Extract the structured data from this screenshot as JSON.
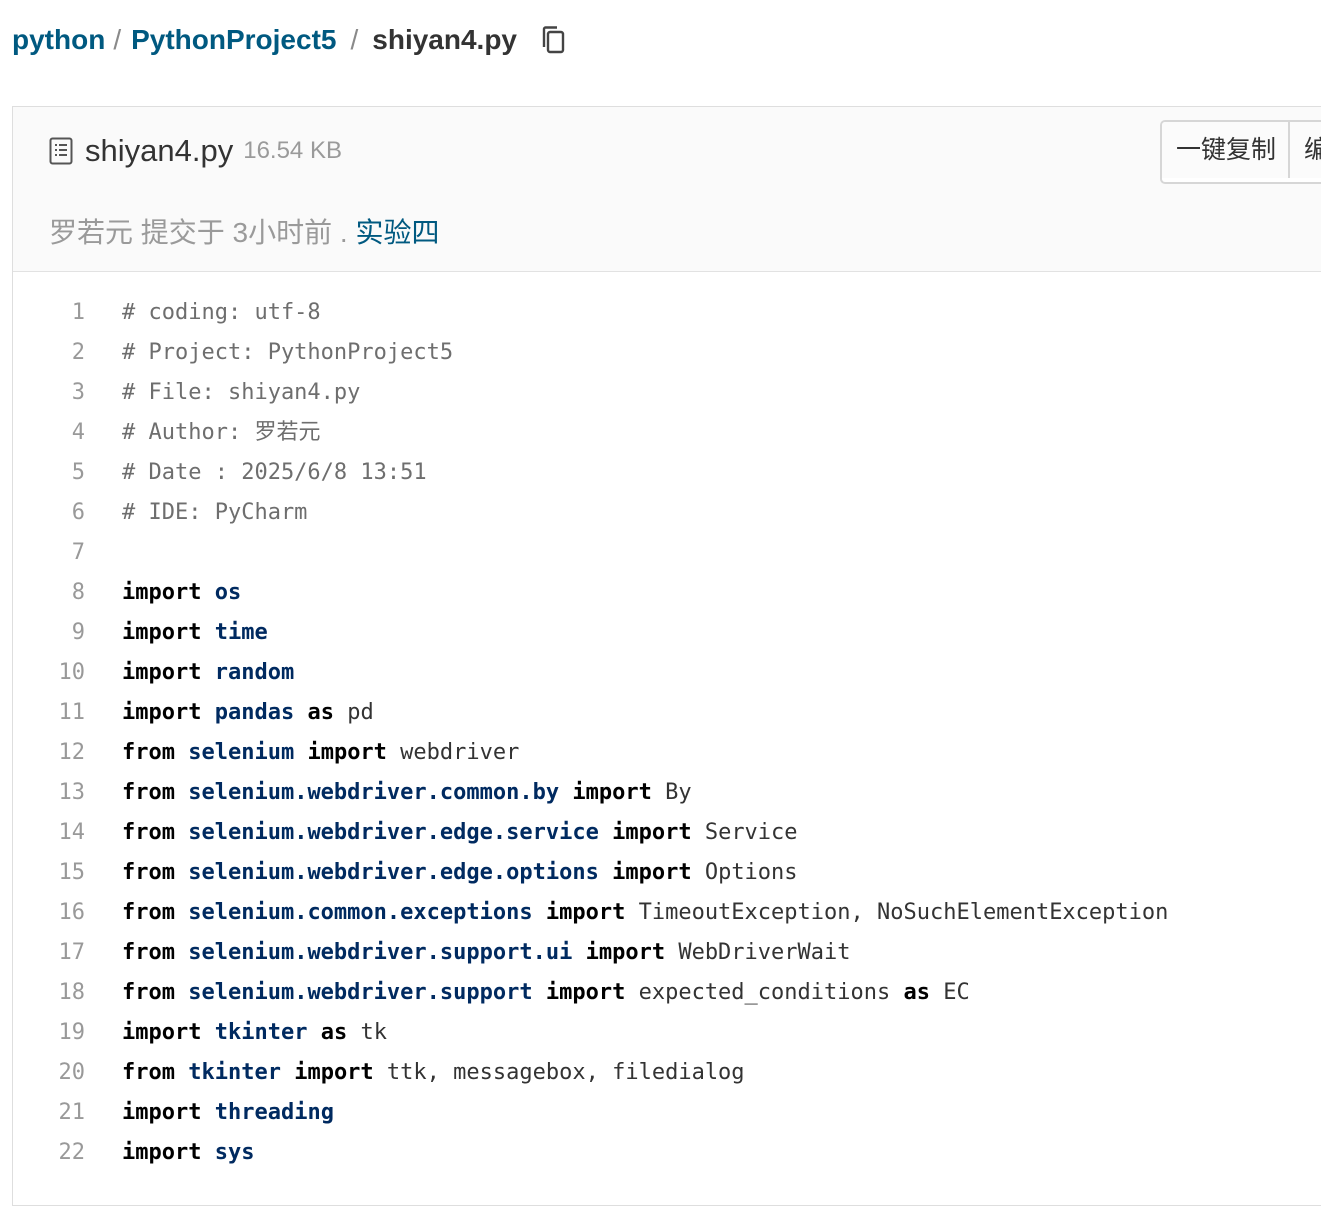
{
  "breadcrumb": {
    "items": [
      {
        "label": "python",
        "type": "link"
      },
      {
        "label": "PythonProject5",
        "type": "link"
      },
      {
        "label": "shiyan4.py",
        "type": "current"
      }
    ],
    "separator": "/",
    "copy_icon": "copy-icon"
  },
  "file": {
    "icon": "file-text-icon",
    "name": "shiyan4.py",
    "size": "16.54 KB"
  },
  "actions": {
    "copy_all_label": "一键复制",
    "edit_label": "编"
  },
  "commit": {
    "prefix": "罗若元 提交于 3小时前 . ",
    "message": "实验四"
  },
  "colors": {
    "link": "#005980",
    "module": "#002a60",
    "comment": "#6e6e6e",
    "line_number": "#999999"
  },
  "code_lines": [
    {
      "num": "1",
      "tokens": [
        {
          "t": "# coding: utf-8",
          "c": "comment"
        }
      ]
    },
    {
      "num": "2",
      "tokens": [
        {
          "t": "# Project: PythonProject5",
          "c": "comment"
        }
      ]
    },
    {
      "num": "3",
      "tokens": [
        {
          "t": "# File: shiyan4.py",
          "c": "comment"
        }
      ]
    },
    {
      "num": "4",
      "tokens": [
        {
          "t": "# Author: 罗若元",
          "c": "comment"
        }
      ]
    },
    {
      "num": "5",
      "tokens": [
        {
          "t": "# Date : 2025/6/8 13:51",
          "c": "comment"
        }
      ]
    },
    {
      "num": "6",
      "tokens": [
        {
          "t": "# IDE: PyCharm",
          "c": "comment"
        }
      ]
    },
    {
      "num": "7",
      "tokens": []
    },
    {
      "num": "8",
      "tokens": [
        {
          "t": "import",
          "c": "kw"
        },
        {
          "t": " "
        },
        {
          "t": "os",
          "c": "mod"
        }
      ]
    },
    {
      "num": "9",
      "tokens": [
        {
          "t": "import",
          "c": "kw"
        },
        {
          "t": " "
        },
        {
          "t": "time",
          "c": "mod"
        }
      ]
    },
    {
      "num": "10",
      "tokens": [
        {
          "t": "import",
          "c": "kw"
        },
        {
          "t": " "
        },
        {
          "t": "random",
          "c": "mod"
        }
      ]
    },
    {
      "num": "11",
      "tokens": [
        {
          "t": "import",
          "c": "kw"
        },
        {
          "t": " "
        },
        {
          "t": "pandas",
          "c": "mod"
        },
        {
          "t": " "
        },
        {
          "t": "as",
          "c": "kw"
        },
        {
          "t": " pd"
        }
      ]
    },
    {
      "num": "12",
      "tokens": [
        {
          "t": "from",
          "c": "kw"
        },
        {
          "t": " "
        },
        {
          "t": "selenium",
          "c": "mod"
        },
        {
          "t": " "
        },
        {
          "t": "import",
          "c": "kw"
        },
        {
          "t": " webdriver"
        }
      ]
    },
    {
      "num": "13",
      "tokens": [
        {
          "t": "from",
          "c": "kw"
        },
        {
          "t": " "
        },
        {
          "t": "selenium.webdriver.common.by",
          "c": "mod"
        },
        {
          "t": " "
        },
        {
          "t": "import",
          "c": "kw"
        },
        {
          "t": " By"
        }
      ]
    },
    {
      "num": "14",
      "tokens": [
        {
          "t": "from",
          "c": "kw"
        },
        {
          "t": " "
        },
        {
          "t": "selenium.webdriver.edge.service",
          "c": "mod"
        },
        {
          "t": " "
        },
        {
          "t": "import",
          "c": "kw"
        },
        {
          "t": " Service"
        }
      ]
    },
    {
      "num": "15",
      "tokens": [
        {
          "t": "from",
          "c": "kw"
        },
        {
          "t": " "
        },
        {
          "t": "selenium.webdriver.edge.options",
          "c": "mod"
        },
        {
          "t": " "
        },
        {
          "t": "import",
          "c": "kw"
        },
        {
          "t": " Options"
        }
      ]
    },
    {
      "num": "16",
      "tokens": [
        {
          "t": "from",
          "c": "kw"
        },
        {
          "t": " "
        },
        {
          "t": "selenium.common.exceptions",
          "c": "mod"
        },
        {
          "t": " "
        },
        {
          "t": "import",
          "c": "kw"
        },
        {
          "t": " TimeoutException, NoSuchElementException"
        }
      ]
    },
    {
      "num": "17",
      "tokens": [
        {
          "t": "from",
          "c": "kw"
        },
        {
          "t": " "
        },
        {
          "t": "selenium.webdriver.support.ui",
          "c": "mod"
        },
        {
          "t": " "
        },
        {
          "t": "import",
          "c": "kw"
        },
        {
          "t": " WebDriverWait"
        }
      ]
    },
    {
      "num": "18",
      "tokens": [
        {
          "t": "from",
          "c": "kw"
        },
        {
          "t": " "
        },
        {
          "t": "selenium.webdriver.support",
          "c": "mod"
        },
        {
          "t": " "
        },
        {
          "t": "import",
          "c": "kw"
        },
        {
          "t": " expected_conditions "
        },
        {
          "t": "as",
          "c": "kw"
        },
        {
          "t": " EC"
        }
      ]
    },
    {
      "num": "19",
      "tokens": [
        {
          "t": "import",
          "c": "kw"
        },
        {
          "t": " "
        },
        {
          "t": "tkinter",
          "c": "mod"
        },
        {
          "t": " "
        },
        {
          "t": "as",
          "c": "kw"
        },
        {
          "t": " tk"
        }
      ]
    },
    {
      "num": "20",
      "tokens": [
        {
          "t": "from",
          "c": "kw"
        },
        {
          "t": " "
        },
        {
          "t": "tkinter",
          "c": "mod"
        },
        {
          "t": " "
        },
        {
          "t": "import",
          "c": "kw"
        },
        {
          "t": " ttk, messagebox, filedialog"
        }
      ]
    },
    {
      "num": "21",
      "tokens": [
        {
          "t": "import",
          "c": "kw"
        },
        {
          "t": " "
        },
        {
          "t": "threading",
          "c": "mod"
        }
      ]
    },
    {
      "num": "22",
      "tokens": [
        {
          "t": "import",
          "c": "kw"
        },
        {
          "t": " "
        },
        {
          "t": "sys",
          "c": "mod"
        }
      ]
    }
  ]
}
